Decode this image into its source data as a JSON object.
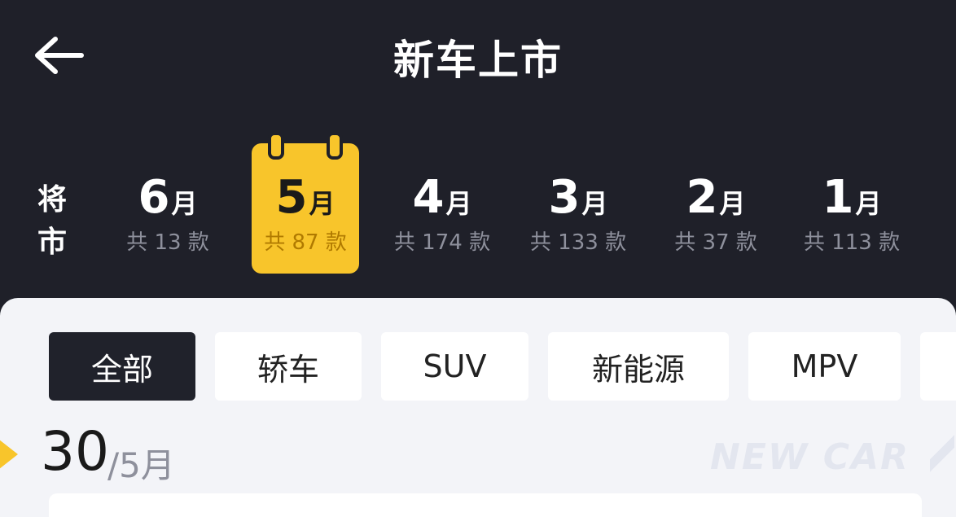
{
  "header": {
    "title": "新车上市",
    "back_icon": "arrow-left-icon"
  },
  "month_bar": {
    "upcoming_label_1": "将",
    "upcoming_label_2": "市",
    "active_index": 1,
    "accent_color": "#f8c52b",
    "months": [
      {
        "num": "6",
        "unit": "月",
        "count": "共 13 款"
      },
      {
        "num": "5",
        "unit": "月",
        "count": "共 87 款"
      },
      {
        "num": "4",
        "unit": "月",
        "count": "共 174 款"
      },
      {
        "num": "3",
        "unit": "月",
        "count": "共 133 款"
      },
      {
        "num": "2",
        "unit": "月",
        "count": "共 37 款"
      },
      {
        "num": "1",
        "unit": "月",
        "count": "共 113 款"
      }
    ]
  },
  "filter_tabs": {
    "active_index": 0,
    "items": [
      {
        "label": "全部"
      },
      {
        "label": "轿车"
      },
      {
        "label": "SUV"
      },
      {
        "label": "新能源"
      },
      {
        "label": "MPV"
      }
    ]
  },
  "date_section": {
    "day": "30",
    "month": "/5月",
    "watermark": "NEW CAR"
  }
}
